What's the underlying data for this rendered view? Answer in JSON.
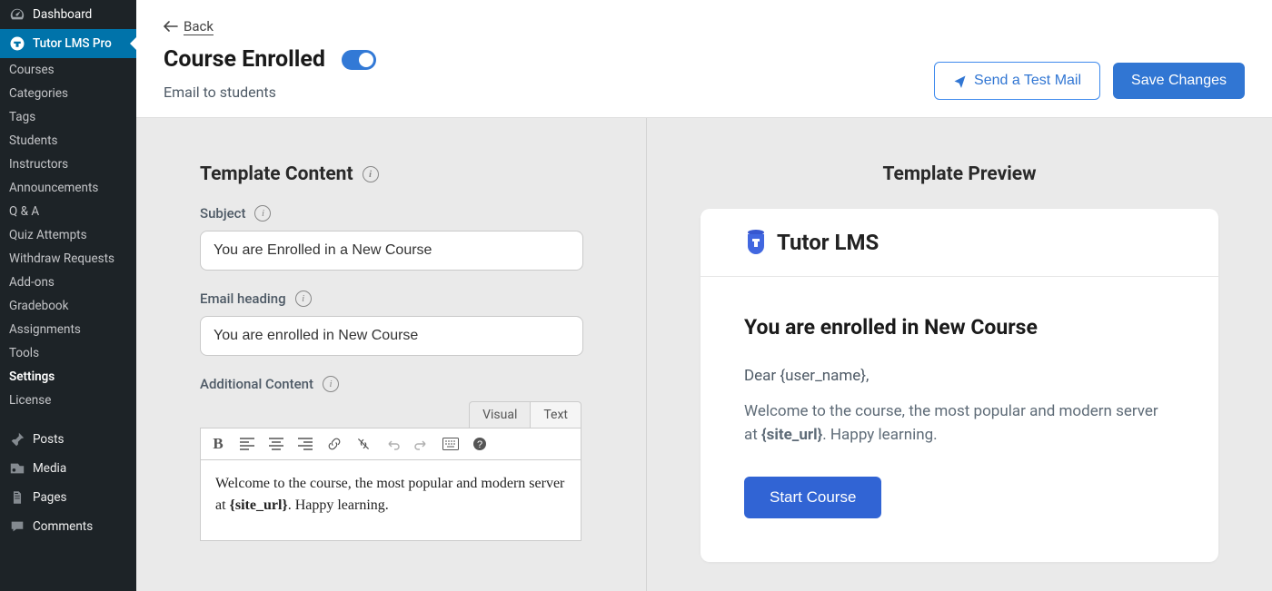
{
  "sidebar": {
    "dashboard": "Dashboard",
    "tutor": "Tutor LMS Pro",
    "items": [
      "Courses",
      "Categories",
      "Tags",
      "Students",
      "Instructors",
      "Announcements",
      "Q & A",
      "Quiz Attempts",
      "Withdraw Requests",
      "Add-ons",
      "Gradebook",
      "Assignments",
      "Tools",
      "Settings",
      "License"
    ],
    "bottom": {
      "posts": "Posts",
      "media": "Media",
      "pages": "Pages",
      "comments": "Comments"
    }
  },
  "header": {
    "back": "Back",
    "title": "Course Enrolled",
    "subtitle": "Email to students",
    "send_test": "Send a Test Mail",
    "save": "Save Changes"
  },
  "content": {
    "section_title": "Template Content",
    "subject_label": "Subject",
    "subject_value": "You are Enrolled in a New Course",
    "heading_label": "Email heading",
    "heading_value": "You are enrolled in New Course",
    "additional_label": "Additional Content",
    "tab_visual": "Visual",
    "tab_text": "Text",
    "editor_pre": "Welcome to the course, the most popular and modern server at ",
    "editor_var": "{site_url}",
    "editor_post": ". Happy learning."
  },
  "preview": {
    "title": "Template Preview",
    "brand": "Tutor LMS",
    "heading": "You are enrolled in New Course",
    "greeting": "Dear {user_name},",
    "body_pre": "Welcome to the course, the most popular and modern server at ",
    "body_var": "{site_url}",
    "body_post": ". Happy learning.",
    "cta": "Start Course"
  }
}
